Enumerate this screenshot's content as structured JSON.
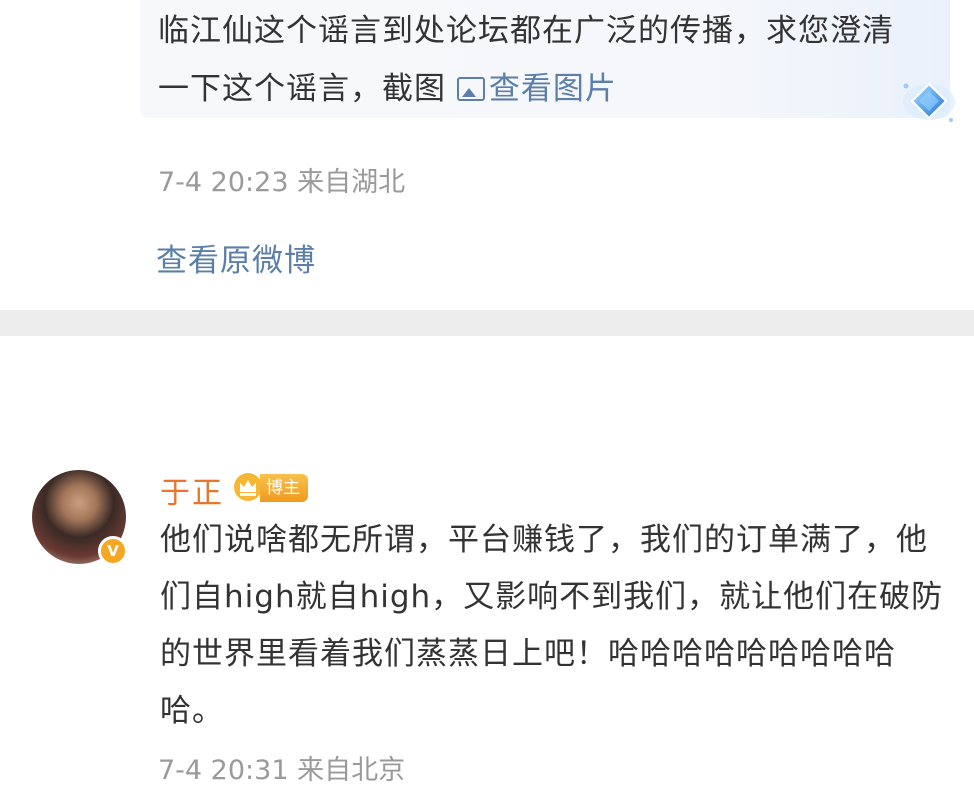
{
  "quoted_post": {
    "text": "临江仙这个谣言到处论坛都在广泛的传播，求您澄清一下这个谣言，截图",
    "view_pic_label": "查看图片",
    "meta": "7-4 20:23 来自湖北",
    "view_original_label": "查看原微博"
  },
  "reply": {
    "author": "于正",
    "author_tag": "博主",
    "verify_mark": "V",
    "text": "他们说啥都无所谓，平台赚钱了，我们的订单满了，他们自high就自high，又影响不到我们，就让他们在破防的世界里看着我们蒸蒸日上吧！哈哈哈哈哈哈哈哈哈哈。",
    "meta": "7-4 20:31 来自北京"
  },
  "colors": {
    "link": "#5b7fa8",
    "author": "#e8752b",
    "meta": "#9a9a9a",
    "divider": "#ededed"
  },
  "icons": {
    "picture": "image-icon",
    "badge": "diamond-badge-icon",
    "crown": "crown-icon",
    "verified": "verified-icon"
  }
}
